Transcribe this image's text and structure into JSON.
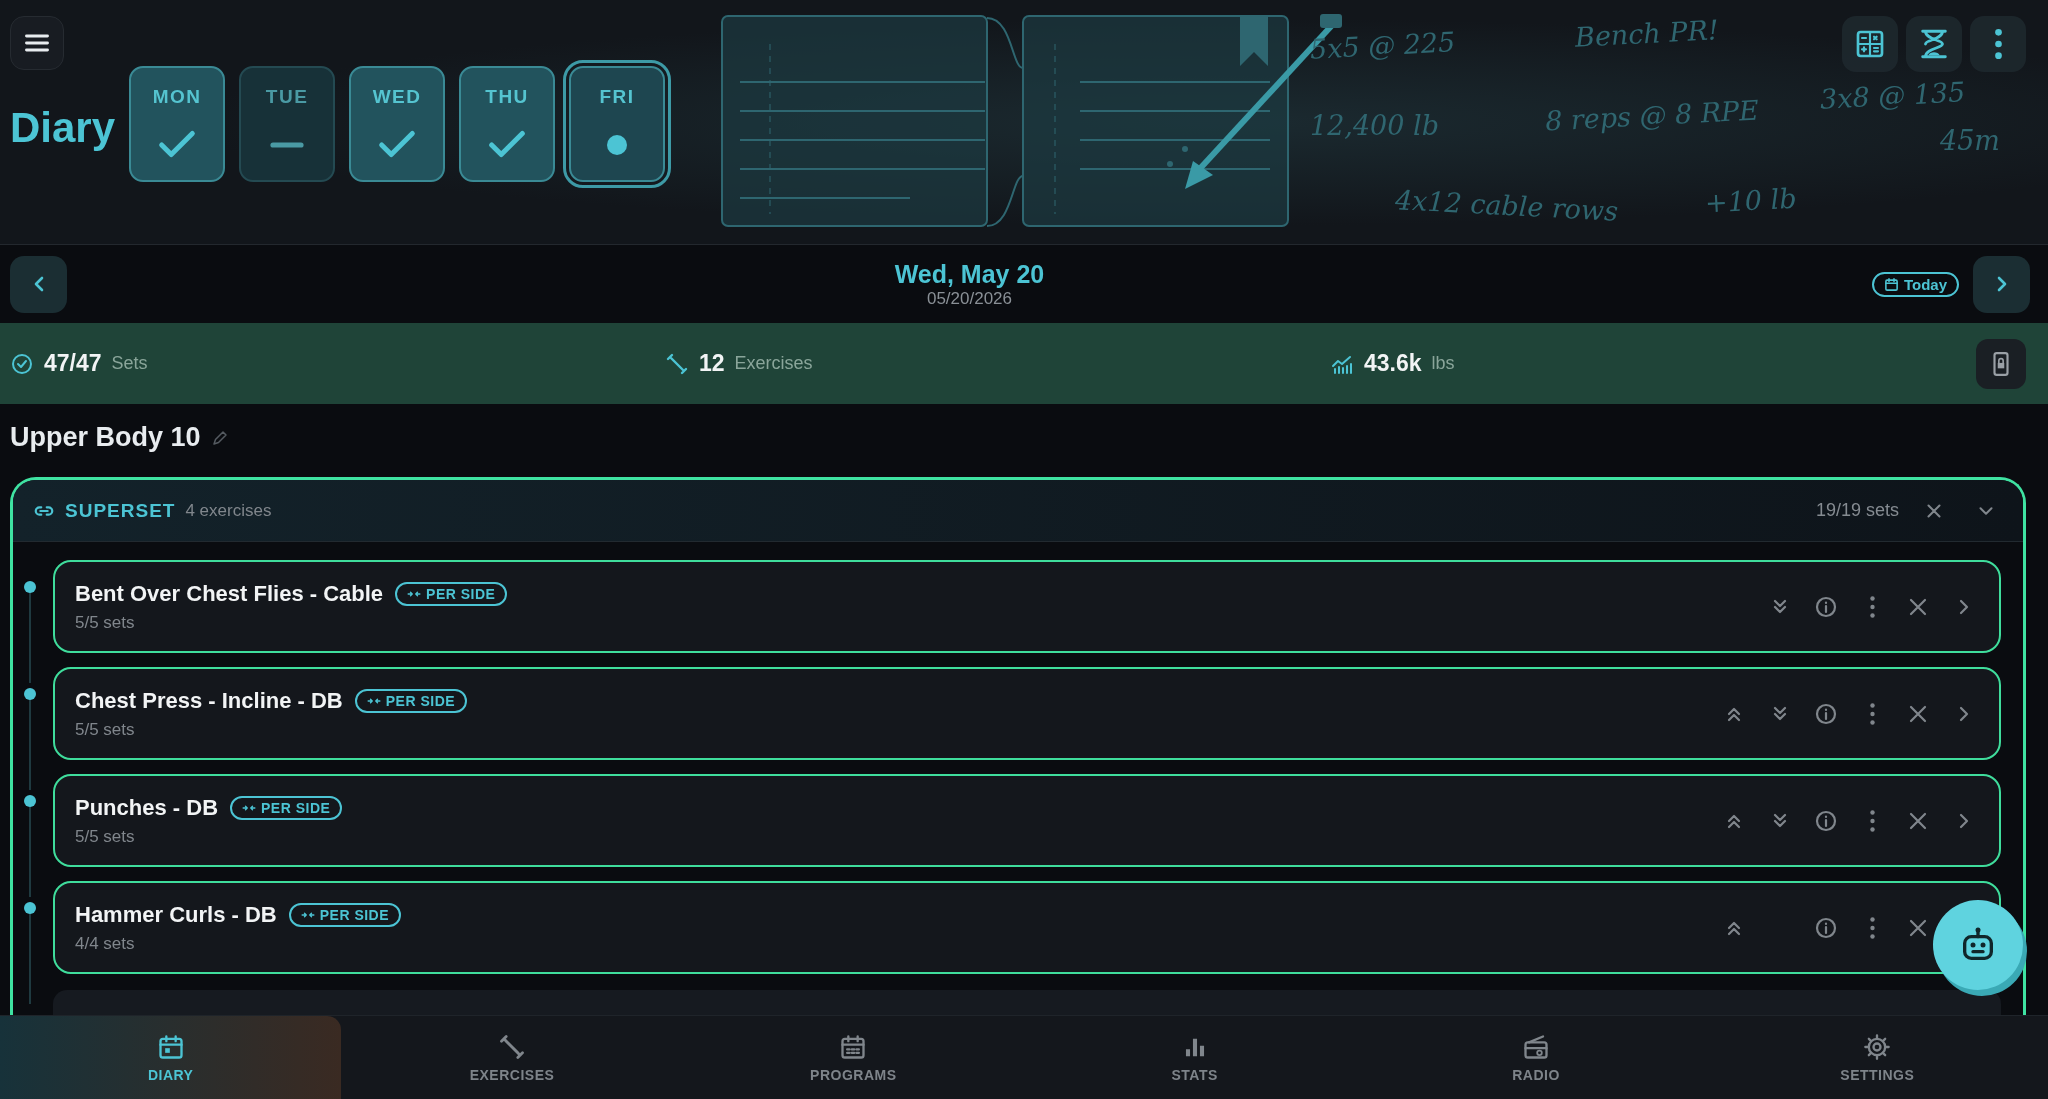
{
  "header": {
    "title": "Diary",
    "days": [
      {
        "label": "MON",
        "kind": "done",
        "selected": false
      },
      {
        "label": "TUE",
        "kind": "skipped",
        "selected": false
      },
      {
        "label": "WED",
        "kind": "done",
        "selected": false
      },
      {
        "label": "THU",
        "kind": "done",
        "selected": false
      },
      {
        "label": "FRI",
        "kind": "pending",
        "selected": true
      }
    ],
    "notes": [
      "5x5 @ 225",
      "Bench PR!",
      "3x8 @ 135",
      "12,400 lb",
      "8 reps @ 8 RPE",
      "45m",
      "4x12 cable rows",
      "+10 lb"
    ]
  },
  "date_nav": {
    "date": "Wed, May 20",
    "subdate": "05/20/2026",
    "today": "Today"
  },
  "stats": [
    {
      "kind": "sets",
      "value": "47/47",
      "unit": "Sets"
    },
    {
      "kind": "exercises",
      "value": "12",
      "unit": "Exercises"
    },
    {
      "kind": "volume",
      "value": "43.6k",
      "unit": "lbs"
    }
  ],
  "workout": {
    "title": "Upper Body 10",
    "superset": {
      "label": "SUPERSET",
      "count": "4 exercises",
      "progress": "19/19 sets",
      "exercises": [
        {
          "name": "Bent Over Chest Flies - Cable",
          "badge": "PER SIDE",
          "sets": "5/5 sets",
          "move_up": false,
          "move_down": true,
          "open_arrow": true
        },
        {
          "name": "Chest Press - Incline - DB",
          "badge": "PER SIDE",
          "sets": "5/5 sets",
          "move_up": true,
          "move_down": true,
          "open_arrow": true
        },
        {
          "name": "Punches - DB",
          "badge": "PER SIDE",
          "sets": "5/5 sets",
          "move_up": true,
          "move_down": true,
          "open_arrow": true
        },
        {
          "name": "Hammer Curls - DB",
          "badge": "PER SIDE",
          "sets": "4/4 sets",
          "move_up": true,
          "move_down": false,
          "open_arrow": false
        }
      ]
    }
  },
  "nav": [
    {
      "label": "DIARY",
      "kind": "diary",
      "selected": true
    },
    {
      "label": "EXERCISES",
      "kind": "exercises",
      "selected": false
    },
    {
      "label": "PROGRAMS",
      "kind": "programs",
      "selected": false
    },
    {
      "label": "STATS",
      "kind": "stats",
      "selected": false
    },
    {
      "label": "RADIO",
      "kind": "radio",
      "selected": false
    },
    {
      "label": "SETTINGS",
      "kind": "settings",
      "selected": false
    }
  ]
}
